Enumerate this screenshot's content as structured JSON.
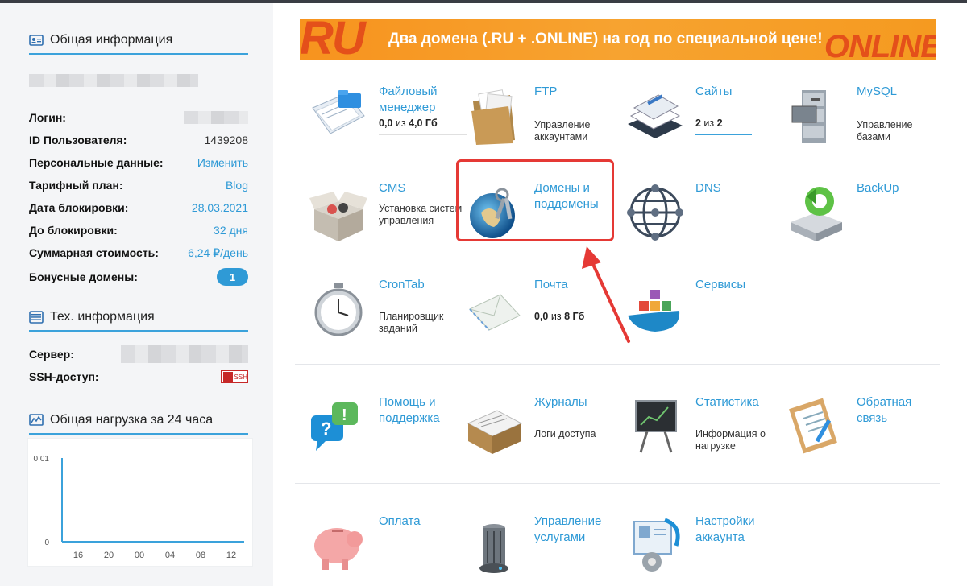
{
  "sidebar": {
    "general": {
      "title": "Общая информация",
      "rows": [
        {
          "label": "Логин:",
          "value": ""
        },
        {
          "label": "ID Пользователя:",
          "value": "1439208"
        },
        {
          "label": "Персональные данные:",
          "value": "Изменить"
        },
        {
          "label": "Тарифный план:",
          "value": "Blog"
        },
        {
          "label": "Дата блокировки:",
          "value": "28.03.2021"
        },
        {
          "label": "До блокировки:",
          "value": "32 дня"
        },
        {
          "label": "Суммарная стоимость:",
          "value": "6,24 ₽/день"
        },
        {
          "label": "Бонусные домены:",
          "value": "1"
        }
      ]
    },
    "tech": {
      "title": "Тех. информация",
      "rows": [
        {
          "label": "Сервер:",
          "value": ""
        },
        {
          "label": "SSH-доступ:",
          "value": "SSH"
        }
      ]
    },
    "load": {
      "title": "Общая нагрузка за 24 часа"
    }
  },
  "chart_data": {
    "type": "line",
    "y_ticks": [
      "0.01",
      "0"
    ],
    "x_ticks": [
      "16",
      "20",
      "00",
      "04",
      "08",
      "12"
    ],
    "ylim": [
      0,
      0.01
    ],
    "series": [
      {
        "values": [
          0,
          0,
          0,
          0,
          0,
          0
        ]
      }
    ],
    "colors": {
      "line": "#3ba2db"
    }
  },
  "banner": {
    "text": "Два домена (.RU + .ONLINE) на год по специальной цене!",
    "left_logo": "RU",
    "right_logo": "ONLINE"
  },
  "tiles": [
    {
      "id": "file-manager",
      "title": "Файловый менеджер",
      "usage_a": "0,0",
      "usage_mid": " из ",
      "usage_b": "4,0 Гб"
    },
    {
      "id": "ftp",
      "title": "FTP",
      "sub": "Управление аккаунтами"
    },
    {
      "id": "sites",
      "title": "Сайты",
      "usage_a": "2",
      "usage_mid": " из ",
      "usage_b": "2"
    },
    {
      "id": "mysql",
      "title": "MySQL",
      "sub": "Управление базами"
    },
    {
      "id": "cms",
      "title": "CMS",
      "sub": "Установка систем управления"
    },
    {
      "id": "domains",
      "title": "Домены и поддомены"
    },
    {
      "id": "dns",
      "title": "DNS"
    },
    {
      "id": "backup",
      "title": "BackUp"
    },
    {
      "id": "crontab",
      "title": "CronTab",
      "sub": "Планировщик заданий"
    },
    {
      "id": "mail",
      "title": "Почта",
      "usage_a": "0,0",
      "usage_mid": " из ",
      "usage_b": "8 Гб"
    },
    {
      "id": "services",
      "title": "Сервисы"
    },
    {
      "id": "help",
      "title": "Помощь и поддержка"
    },
    {
      "id": "logs",
      "title": "Журналы",
      "sub": "Логи доступа"
    },
    {
      "id": "stats",
      "title": "Статистика",
      "sub": "Информация о нагрузке"
    },
    {
      "id": "feedback",
      "title": "Обратная связь"
    },
    {
      "id": "payment",
      "title": "Оплата"
    },
    {
      "id": "manage-services",
      "title": "Управление услугами"
    },
    {
      "id": "account-settings",
      "title": "Настройки аккаунта"
    }
  ],
  "colors": {
    "accent": "#2f9ad6",
    "highlight": "#e53935",
    "banner": "#f7931e"
  }
}
